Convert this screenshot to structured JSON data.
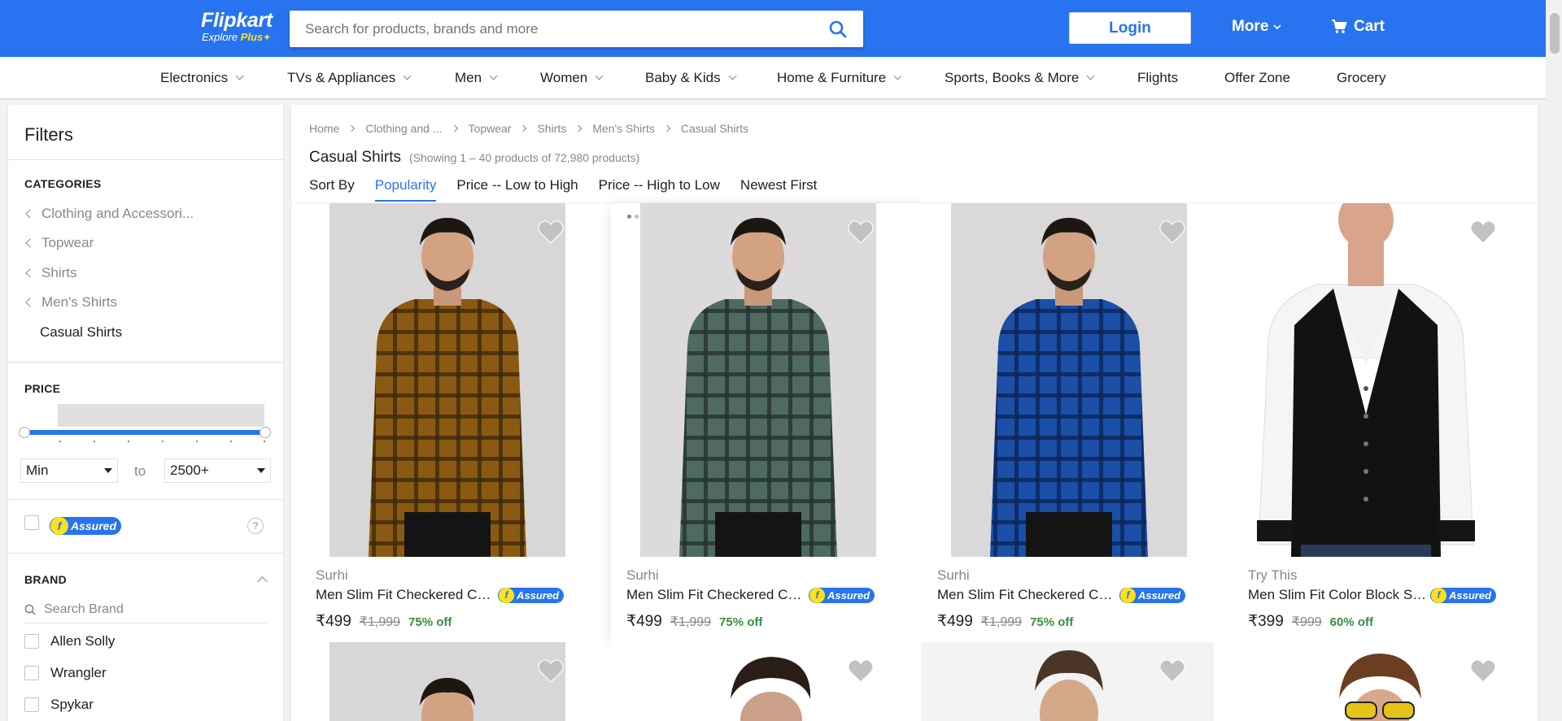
{
  "header": {
    "logo_main": "Flipkart",
    "logo_sub": "Explore",
    "logo_plus": "Plus",
    "search_placeholder": "Search for products, brands and more",
    "login_label": "Login",
    "more_label": "More",
    "cart_label": "Cart"
  },
  "nav": [
    {
      "label": "Electronics",
      "chevron": true
    },
    {
      "label": "TVs & Appliances",
      "chevron": true
    },
    {
      "label": "Men",
      "chevron": true
    },
    {
      "label": "Women",
      "chevron": true
    },
    {
      "label": "Baby & Kids",
      "chevron": true
    },
    {
      "label": "Home & Furniture",
      "chevron": true
    },
    {
      "label": "Sports, Books & More",
      "chevron": true
    },
    {
      "label": "Flights",
      "chevron": false
    },
    {
      "label": "Offer Zone",
      "chevron": false
    },
    {
      "label": "Grocery",
      "chevron": false
    }
  ],
  "filters": {
    "title": "Filters",
    "categories_heading": "CATEGORIES",
    "category_links": [
      "Clothing and Accessori...",
      "Topwear",
      "Shirts",
      "Men's Shirts"
    ],
    "current_category": "Casual Shirts",
    "price_heading": "PRICE",
    "price_min": "Min",
    "price_to": "to",
    "price_max": "2500+",
    "assured_label": "Assured",
    "help_label": "?",
    "brand_heading": "BRAND",
    "brand_search_placeholder": "Search Brand",
    "brands": [
      "Allen Solly",
      "Wrangler",
      "Spykar"
    ]
  },
  "results": {
    "breadcrumb": [
      "Home",
      "Clothing and ...",
      "Topwear",
      "Shirts",
      "Men's Shirts",
      "Casual Shirts"
    ],
    "title": "Casual Shirts",
    "count_text": "(Showing 1 – 40 products of 72,980 products)",
    "sort_label": "Sort By",
    "sort_options": [
      "Popularity",
      "Price -- Low to High",
      "Price -- High to Low",
      "Newest First"
    ],
    "active_sort": "Popularity"
  },
  "products": [
    {
      "brand": "Surhi",
      "title": "Men Slim Fit Checkered Ca...",
      "price": "₹499",
      "mrp": "₹1,999",
      "off": "75% off",
      "assured": "Assured",
      "shirt_color": "#8a5a12",
      "check_color": "#3b2608"
    },
    {
      "brand": "Surhi",
      "title": "Men Slim Fit Checkered Ca...",
      "price": "₹499",
      "mrp": "₹1,999",
      "off": "75% off",
      "assured": "Assured",
      "shirt_color": "#4f6a60",
      "check_color": "#24332d"
    },
    {
      "brand": "Surhi",
      "title": "Men Slim Fit Checkered Ca...",
      "price": "₹499",
      "mrp": "₹1,999",
      "off": "75% off",
      "assured": "Assured",
      "shirt_color": "#1b4fa8",
      "check_color": "#0b2557"
    },
    {
      "brand": "Try This",
      "title": "Men Slim Fit Color Block Sp...",
      "price": "₹399",
      "mrp": "₹999",
      "off": "60% off",
      "assured": "Assured",
      "shirt_color": "#111111",
      "check_color": "#ffffff"
    }
  ],
  "colors": {
    "brand_blue": "#2874f0",
    "assured_yellow": "#ffe11b",
    "discount_green": "#388e3c",
    "muted_gray": "#878787"
  }
}
